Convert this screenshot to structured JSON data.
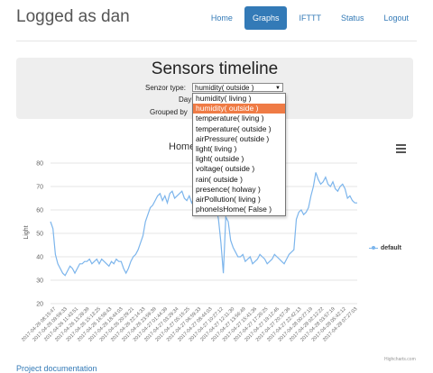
{
  "brand": "Logged as dan",
  "nav": [
    "Home",
    "Graphs",
    "IFTTT",
    "Status",
    "Logout"
  ],
  "panel": {
    "title": "Sensors timeline",
    "sensor_label": "Senzor type:",
    "selected": "humidity( outside )",
    "day_label": "Day",
    "grouped_label": "Grouped by",
    "options": [
      "humidity( living )",
      "humidity( outside )",
      "temperature( living )",
      "temperature( outside )",
      "airPressure( outside )",
      "light( living )",
      "light( outside )",
      "voltage( outside )",
      "rain( outside )",
      "presence( holway )",
      "airPollution( living )",
      "phoneIsHome( False )"
    ]
  },
  "chart_title": "Home",
  "credits": "Highcharts.com",
  "footer_link": "Project documentation",
  "chart_data": {
    "type": "line",
    "ylabel": "Light",
    "ylim": [
      20,
      80
    ],
    "yticks": [
      20,
      30,
      40,
      50,
      60,
      70,
      80
    ],
    "series": [
      {
        "name": "default",
        "color": "#7cb5ec",
        "values": [
          55,
          52,
          41,
          37,
          35,
          33,
          32,
          34,
          36,
          35,
          33,
          35,
          37,
          37,
          38,
          38,
          39,
          37,
          38,
          39,
          37,
          39,
          38,
          37,
          36,
          38,
          37,
          39,
          38,
          38,
          35,
          33,
          35,
          38,
          40,
          41,
          43,
          46,
          49,
          55,
          58,
          61,
          62,
          64,
          66,
          67,
          64,
          66,
          63,
          67,
          68,
          65,
          66,
          67,
          68,
          65,
          64,
          66,
          63,
          65,
          67,
          60,
          59,
          58,
          61,
          63,
          64,
          58,
          61,
          56,
          46,
          33,
          57,
          55,
          47,
          44,
          42,
          40,
          40,
          41,
          38,
          39,
          40,
          37,
          38,
          39,
          41,
          40,
          39,
          37,
          38,
          39,
          41,
          40,
          39,
          38,
          37,
          39,
          41,
          42,
          43,
          56,
          59,
          60,
          58,
          59,
          61,
          66,
          70,
          76,
          73,
          71,
          72,
          74,
          71,
          70,
          72,
          69,
          68,
          70,
          71,
          69,
          65,
          66,
          64,
          63,
          63
        ]
      }
    ],
    "x_labels": [
      "2017-04-26 08:15:47",
      "2017-04-26 09:59:33",
      "2017-04-26 11:43:51",
      "2017-04-26 13:28:39",
      "2017-04-26 15:13:25",
      "2017-04-26 16:58:43",
      "2017-04-26 18:44:03",
      "2017-04-26 20:29:21",
      "2017-04-26 22:14:33",
      "2017-04-26 23:59:39",
      "2017-04-27 01:44:39",
      "2017-04-27 03:29:34",
      "2017-04-27 05:15:25",
      "2017-04-27 06:59:33",
      "2017-04-27 08:44:03",
      "2017-04-27 10:27:12",
      "2017-04-27 12:11:30",
      "2017-04-27 13:56:49",
      "2017-04-27 15:41:36",
      "2017-04-27 17:26:25",
      "2017-04-27 19:12:46",
      "2017-04-27 20:57:36",
      "2017-04-27 22:42:13",
      "2017-04-28 00:27:19",
      "2017-04-28 02:12:22",
      "2017-04-28 03:57:19",
      "2017-04-28 05:42:12",
      "2017-04-28 07:27:03"
    ]
  }
}
